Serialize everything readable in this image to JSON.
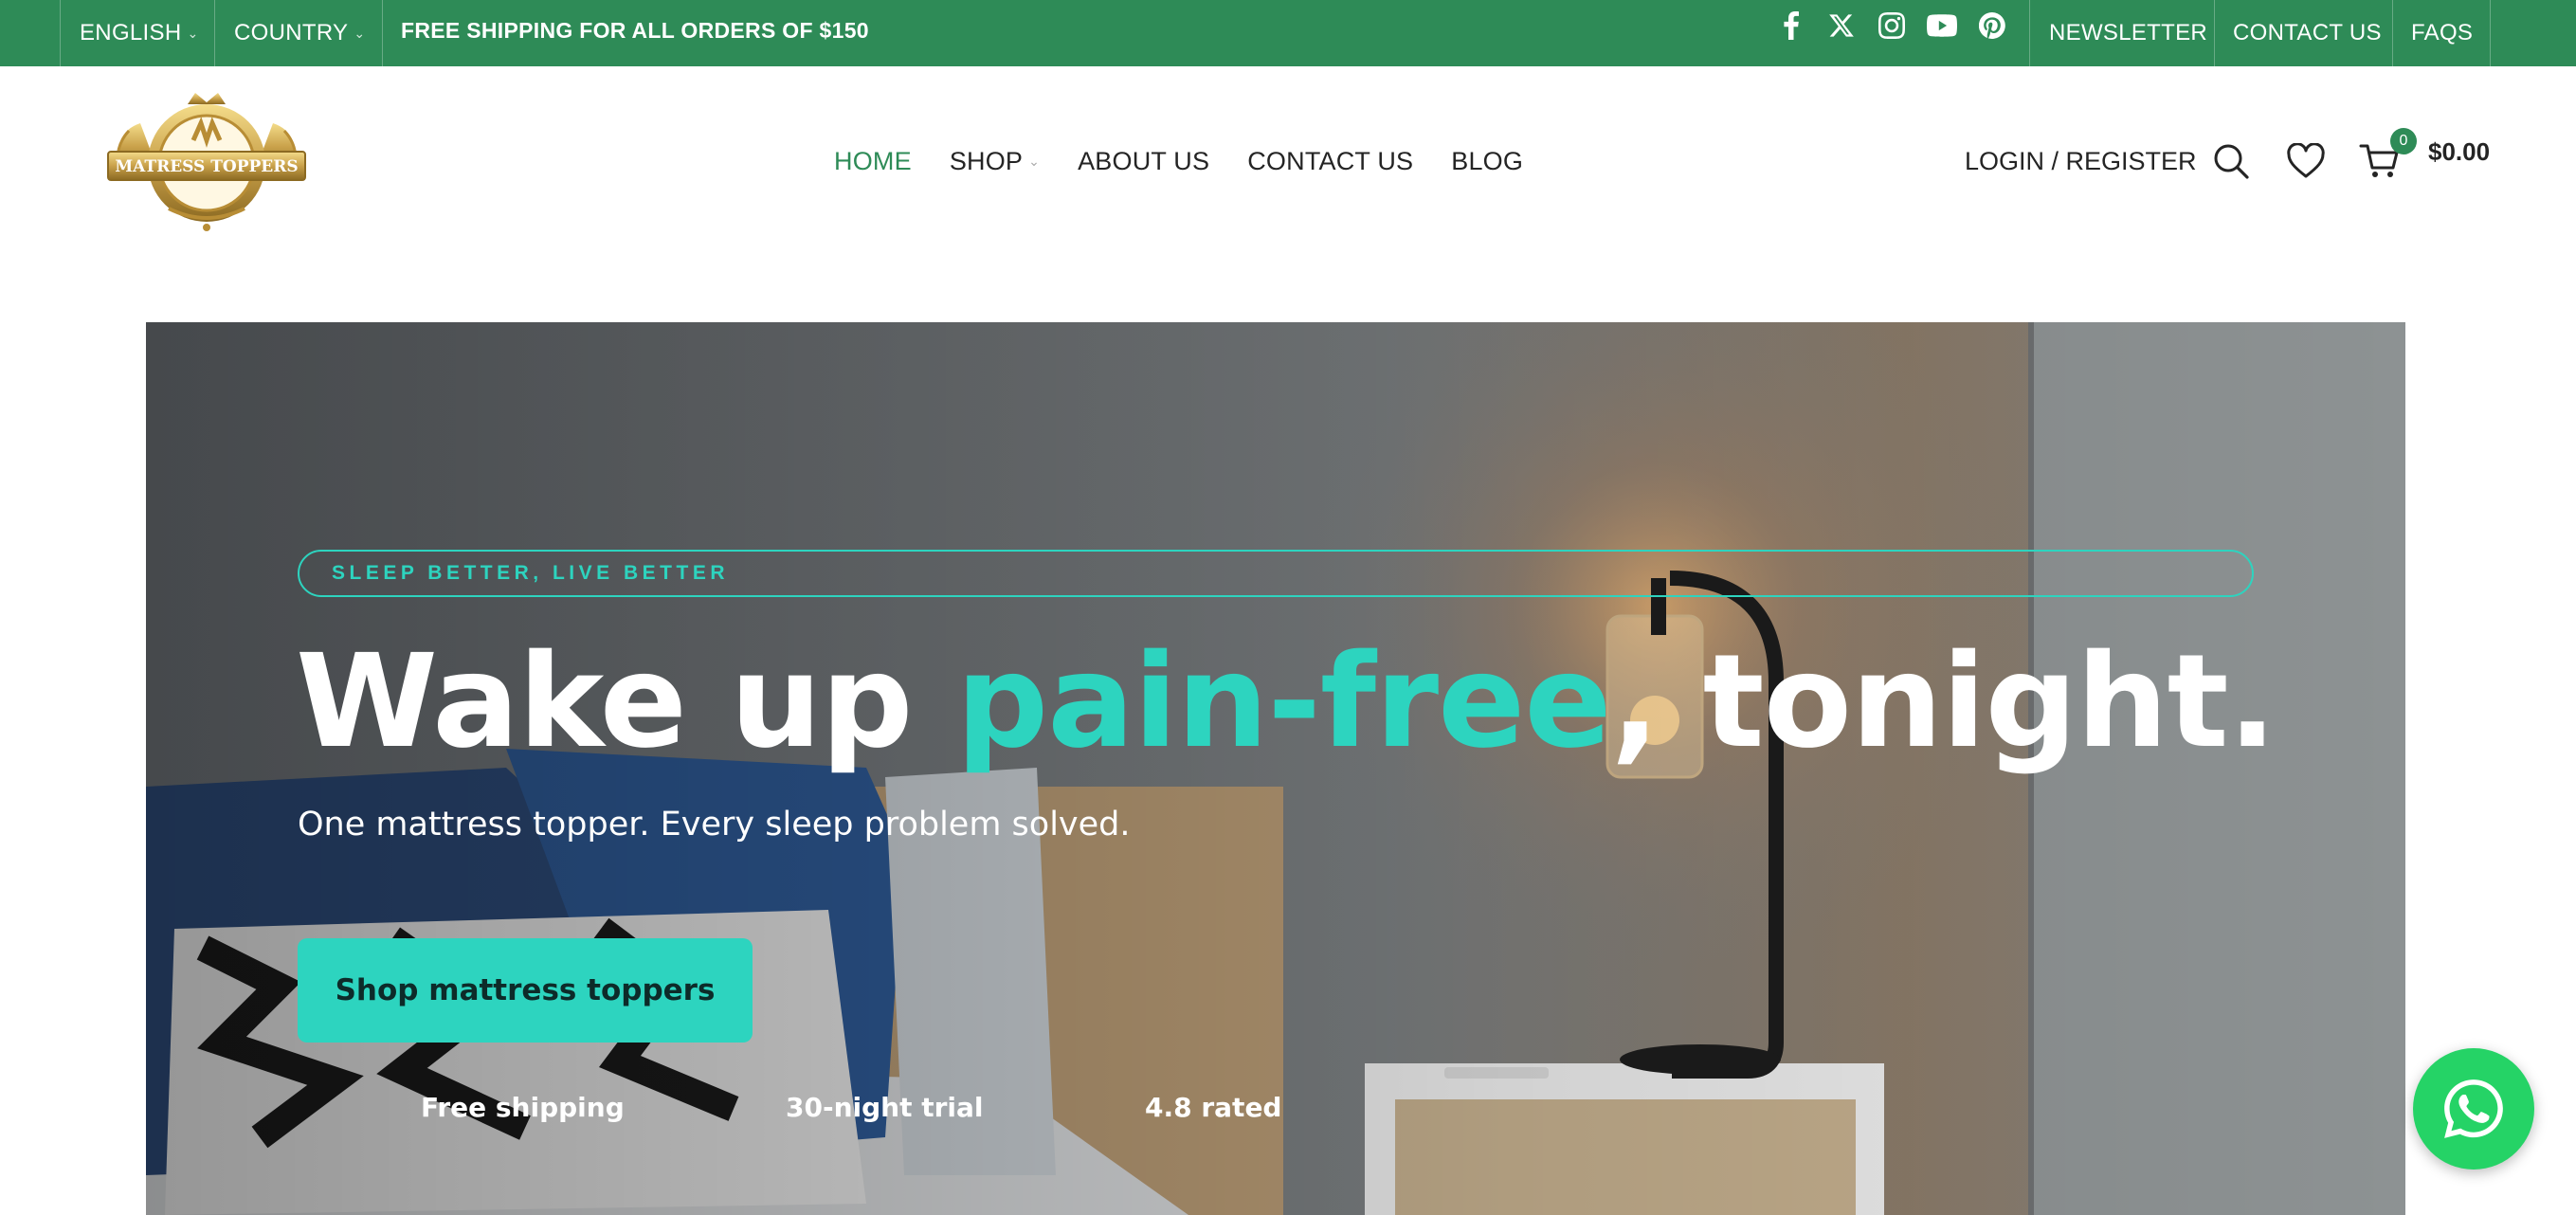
{
  "topbar": {
    "language": "ENGLISH",
    "country": "COUNTRY",
    "promo": "FREE SHIPPING FOR ALL ORDERS OF $150",
    "social": [
      "facebook-icon",
      "x-icon",
      "instagram-icon",
      "youtube-icon",
      "pinterest-icon"
    ],
    "links": [
      "NEWSLETTER",
      "CONTACT US",
      "FAQS"
    ]
  },
  "header": {
    "logo_text": "MATRESS TOPPERS",
    "nav": [
      {
        "label": "HOME",
        "active": true
      },
      {
        "label": "SHOP",
        "dropdown": true
      },
      {
        "label": "ABOUT US"
      },
      {
        "label": "CONTACT US"
      },
      {
        "label": "BLOG"
      }
    ],
    "login": "LOGIN / REGISTER",
    "cart_count": "0",
    "cart_total": "$0.00"
  },
  "hero": {
    "tagline": "SLEEP BETTER, LIVE BETTER",
    "headline_pre": "Wake up ",
    "headline_accent": "pain-free",
    "headline_post": ", tonight.",
    "subline": "One mattress topper. Every sleep problem solved.",
    "cta": "Shop mattress toppers",
    "features": [
      "Free shipping",
      "30-night trial",
      "4.8 rated"
    ]
  },
  "colors": {
    "brand_green": "#2e8b57",
    "accent_teal": "#2dd4bf",
    "whatsapp": "#25d366"
  }
}
